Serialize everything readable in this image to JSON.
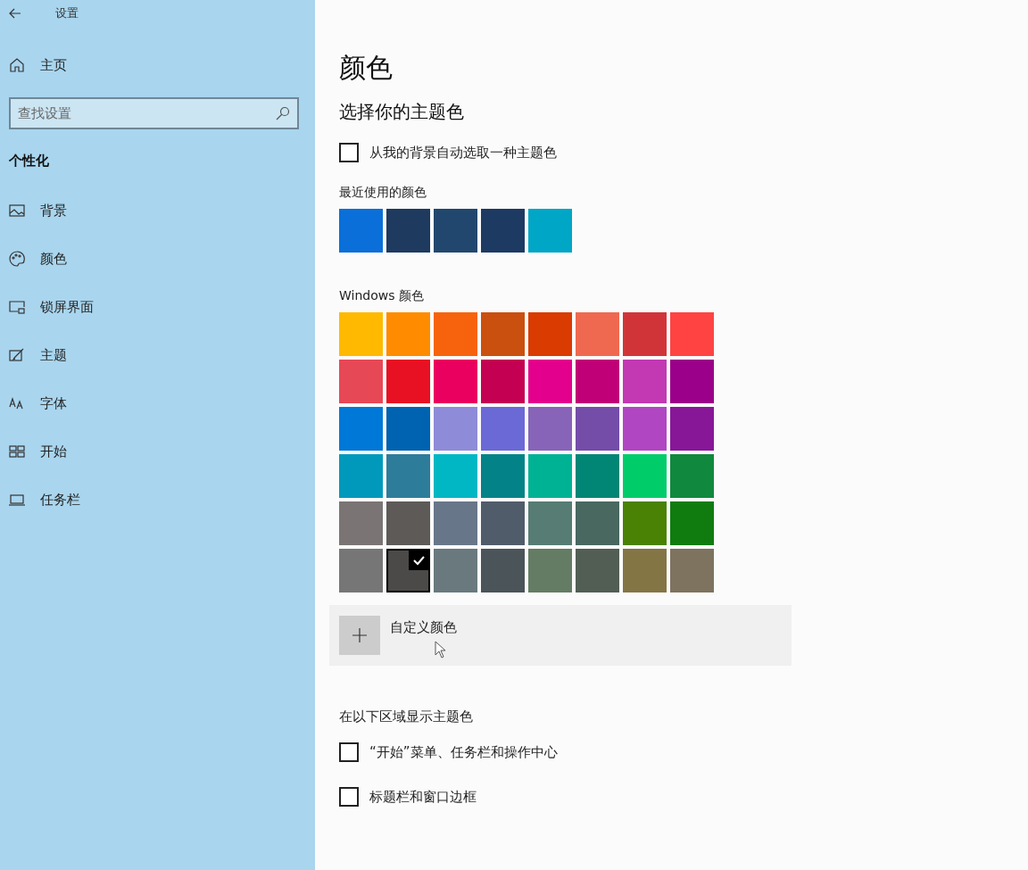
{
  "window": {
    "title": "设置"
  },
  "sidebar": {
    "home": "主页",
    "search": {
      "placeholder": "查找设置"
    },
    "section": "个性化",
    "items": [
      {
        "kind": "background",
        "label": "背景"
      },
      {
        "kind": "colors",
        "label": "颜色"
      },
      {
        "kind": "lockscreen",
        "label": "锁屏界面"
      },
      {
        "kind": "themes",
        "label": "主题"
      },
      {
        "kind": "fonts",
        "label": "字体"
      },
      {
        "kind": "start",
        "label": "开始"
      },
      {
        "kind": "taskbar",
        "label": "任务栏"
      }
    ]
  },
  "page": {
    "title": "颜色",
    "subtitle": "选择你的主题色",
    "auto_pick": {
      "label": "从我的背景自动选取一种主题色",
      "checked": false
    },
    "recent": {
      "label": "最近使用的颜色",
      "colors": [
        {
          "color": "#0a6fd8"
        },
        {
          "color": "#1e3a5f"
        },
        {
          "color": "#22476e"
        },
        {
          "color": "#1d3a63"
        },
        {
          "color": "#00a6c6"
        }
      ]
    },
    "windows_colors": {
      "label": "Windows 颜色",
      "rows": [
        [
          {
            "color": "#ffb900",
            "selected": false
          },
          {
            "color": "#ff8c00",
            "selected": false
          },
          {
            "color": "#f7630c",
            "selected": false
          },
          {
            "color": "#ca5010",
            "selected": false
          },
          {
            "color": "#da3b01",
            "selected": false
          },
          {
            "color": "#ef6950",
            "selected": false
          },
          {
            "color": "#d13438",
            "selected": false
          },
          {
            "color": "#ff4343",
            "selected": false
          }
        ],
        [
          {
            "color": "#e74856",
            "selected": false
          },
          {
            "color": "#e81123",
            "selected": false
          },
          {
            "color": "#ea005e",
            "selected": false
          },
          {
            "color": "#c30052",
            "selected": false
          },
          {
            "color": "#e3008c",
            "selected": false
          },
          {
            "color": "#bf0077",
            "selected": false
          },
          {
            "color": "#c239b3",
            "selected": false
          },
          {
            "color": "#9a0089",
            "selected": false
          }
        ],
        [
          {
            "color": "#0078d7",
            "selected": false
          },
          {
            "color": "#0063b1",
            "selected": false
          },
          {
            "color": "#8e8cd8",
            "selected": false
          },
          {
            "color": "#6b69d6",
            "selected": false
          },
          {
            "color": "#8764b8",
            "selected": false
          },
          {
            "color": "#744da9",
            "selected": false
          },
          {
            "color": "#b146c2",
            "selected": false
          },
          {
            "color": "#881798",
            "selected": false
          }
        ],
        [
          {
            "color": "#0099bc",
            "selected": false
          },
          {
            "color": "#2d7d9a",
            "selected": false
          },
          {
            "color": "#00b7c3",
            "selected": false
          },
          {
            "color": "#038387",
            "selected": false
          },
          {
            "color": "#00b294",
            "selected": false
          },
          {
            "color": "#018574",
            "selected": false
          },
          {
            "color": "#00cc6a",
            "selected": false
          },
          {
            "color": "#10893e",
            "selected": false
          }
        ],
        [
          {
            "color": "#7a7574",
            "selected": false
          },
          {
            "color": "#5d5a58",
            "selected": false
          },
          {
            "color": "#68768a",
            "selected": false
          },
          {
            "color": "#515c6b",
            "selected": false
          },
          {
            "color": "#567c73",
            "selected": false
          },
          {
            "color": "#486860",
            "selected": false
          },
          {
            "color": "#498205",
            "selected": false
          },
          {
            "color": "#107c10",
            "selected": false
          }
        ],
        [
          {
            "color": "#767676",
            "selected": false
          },
          {
            "color": "#4c4a48",
            "selected": true
          },
          {
            "color": "#69797e",
            "selected": false
          },
          {
            "color": "#4a5459",
            "selected": false
          },
          {
            "color": "#647c64",
            "selected": false
          },
          {
            "color": "#525e54",
            "selected": false
          },
          {
            "color": "#847545",
            "selected": false
          },
          {
            "color": "#7e735f",
            "selected": false
          }
        ]
      ]
    },
    "custom_color": {
      "label": "自定义颜色"
    },
    "show_accent": {
      "label": "在以下区域显示主题色",
      "options": [
        {
          "label": "“开始”菜单、任务栏和操作中心",
          "checked": false
        },
        {
          "label": "标题栏和窗口边框",
          "checked": false
        }
      ]
    }
  }
}
